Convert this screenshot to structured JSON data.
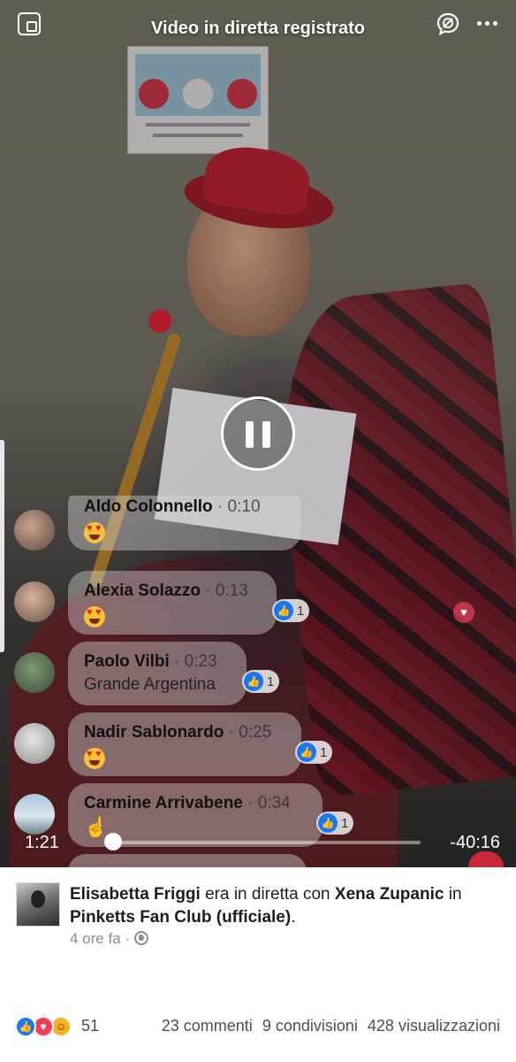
{
  "top_bar": {
    "title": "Video in diretta registrato"
  },
  "comments": [
    {
      "name": "Aldo Colonnello",
      "time": "0:10",
      "text": "",
      "emoji": "heart-eyes",
      "likes": ""
    },
    {
      "name": "Alexia Solazzo",
      "time": "0:13",
      "text": "",
      "emoji": "heart-eyes",
      "likes": "1"
    },
    {
      "name": "Paolo Vilbi",
      "time": "0:23",
      "text": "Grande Argentina",
      "emoji": "",
      "likes": "1"
    },
    {
      "name": "Nadir Sablonardo",
      "time": "0:25",
      "text": "",
      "emoji": "heart-eyes",
      "likes": "1"
    },
    {
      "name": "Carmine Arrivabene",
      "time": "0:34",
      "text": "",
      "emoji": "pointing-hand",
      "likes": "1"
    }
  ],
  "player": {
    "elapsed": "1:21",
    "remaining": "-40:16",
    "progress_fraction": 0.0
  },
  "post": {
    "author": "Elisabetta Friggi",
    "connector1": " era in diretta con ",
    "with_user": "Xena Zupanic",
    "connector2": " in ",
    "group": "Pinketts Fan Club (ufficiale)",
    "end": ".",
    "time_ago": "4 ore fa",
    "meta_sep": " · ",
    "privacy_icon": "globe-icon"
  },
  "stats": {
    "reaction_count": "51",
    "comments": "23 commenti",
    "shares": "9 condivisioni",
    "views": "428 visualizzazioni"
  },
  "colors": {
    "like_blue": "#1877f2",
    "love_red": "#f33e58",
    "haha_yellow": "#f7b125"
  }
}
